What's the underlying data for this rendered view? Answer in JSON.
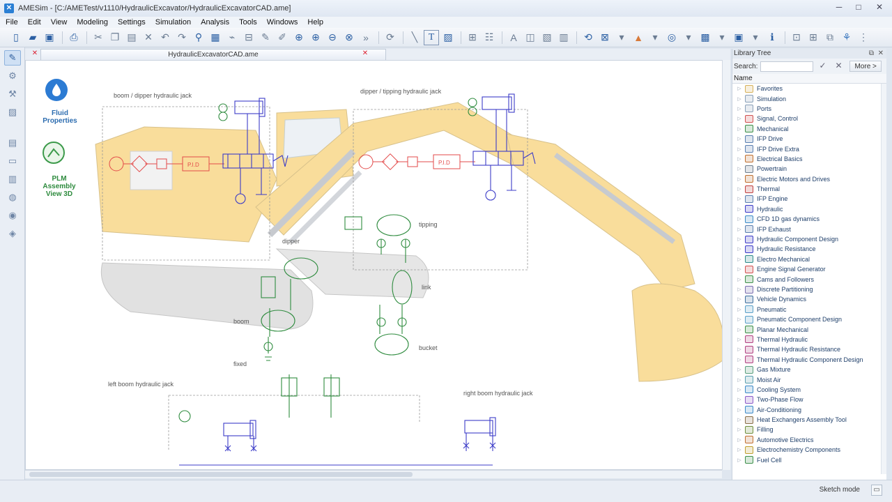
{
  "window": {
    "app_name": "AMESim",
    "path": "[C:/AMETest/v1110/HydraulicExcavator/HydraulicExcavatorCAD.ame]",
    "minimize_glyph": "─",
    "maximize_glyph": "□",
    "close_glyph": "✕"
  },
  "menu": [
    "File",
    "Edit",
    "View",
    "Modeling",
    "Settings",
    "Simulation",
    "Analysis",
    "Tools",
    "Windows",
    "Help"
  ],
  "toolbar": {
    "new_icon": "new-file-icon",
    "open_icon": "open-folder-icon",
    "save_icon": "save-icon",
    "print_icon": "print-icon",
    "text_glyph": "T"
  },
  "document": {
    "tab_title": "HydraulicExcavatorCAD.ame",
    "tab_close": "✕",
    "panel_close": "✕"
  },
  "canvas": {
    "fluid_properties_line1": "Fluid",
    "fluid_properties_line2": "Properties",
    "plm_line1": "PLM",
    "plm_line2": "Assembly",
    "plm_line3": "View 3D",
    "labels": {
      "boom_dipper_jack": "boom / dipper hydraulic jack",
      "dipper_tipping_jack": "dipper / tipping hydraulic jack",
      "tipping": "tipping",
      "dipper": "dipper",
      "link": "link",
      "boom": "boom",
      "bucket": "bucket",
      "fixed": "fixed",
      "left_boom_jack": "left boom hydraulic jack",
      "right_boom_jack": "right boom hydraulic jack",
      "pid_left": "P.I.D",
      "pid_right": "P.I.D"
    },
    "colors": {
      "control_red": "#e34a4a",
      "hydraulic_blue": "#3c3cc8",
      "mechanical_green": "#2e8b3e",
      "excavator_yellow": "#f6c75a"
    }
  },
  "library": {
    "title": "Library Tree",
    "search_label": "Search:",
    "search_value": "",
    "more_label": "More >",
    "column_name": "Name",
    "items": [
      {
        "label": "Favorites",
        "color": "#d6b15a"
      },
      {
        "label": "Simulation",
        "color": "#8aa0b8"
      },
      {
        "label": "Ports",
        "color": "#8aa0b8"
      },
      {
        "label": "Signal, Control",
        "color": "#d05050"
      },
      {
        "label": "Mechanical",
        "color": "#3d8f4a"
      },
      {
        "label": "IFP Drive",
        "color": "#5a7fb0"
      },
      {
        "label": "IFP Drive Extra",
        "color": "#5a7fb0"
      },
      {
        "label": "Electrical Basics",
        "color": "#c07030"
      },
      {
        "label": "Powertrain",
        "color": "#6f7f8f"
      },
      {
        "label": "Electric Motors and Drives",
        "color": "#c07030"
      },
      {
        "label": "Thermal",
        "color": "#c04040"
      },
      {
        "label": "IFP Engine",
        "color": "#5a7fb0"
      },
      {
        "label": "Hydraulic",
        "color": "#3c3cc8"
      },
      {
        "label": "CFD 1D gas dynamics",
        "color": "#3c8ac8"
      },
      {
        "label": "IFP Exhaust",
        "color": "#5a7fb0"
      },
      {
        "label": "Hydraulic Component Design",
        "color": "#3c3cc8"
      },
      {
        "label": "Hydraulic Resistance",
        "color": "#3c3cc8"
      },
      {
        "label": "Electro Mechanical",
        "color": "#2e8b8b"
      },
      {
        "label": "Engine Signal Generator",
        "color": "#d05050"
      },
      {
        "label": "Cams and Followers",
        "color": "#3d8f4a"
      },
      {
        "label": "Discrete Partitioning",
        "color": "#7a6fb0"
      },
      {
        "label": "Vehicle Dynamics",
        "color": "#3d6f9f"
      },
      {
        "label": "Pneumatic",
        "color": "#5aa0c8"
      },
      {
        "label": "Pneumatic Component Design",
        "color": "#5aa0c8"
      },
      {
        "label": "Planar Mechanical",
        "color": "#3d8f4a"
      },
      {
        "label": "Thermal Hydraulic",
        "color": "#b04080"
      },
      {
        "label": "Thermal Hydraulic Resistance",
        "color": "#b04080"
      },
      {
        "label": "Thermal Hydraulic Component Design",
        "color": "#b04080"
      },
      {
        "label": "Gas Mixture",
        "color": "#5a9f7f"
      },
      {
        "label": "Moist Air",
        "color": "#5a9fb0"
      },
      {
        "label": "Cooling System",
        "color": "#3c8ac8"
      },
      {
        "label": "Two-Phase Flow",
        "color": "#8a5ac8"
      },
      {
        "label": "Air-Conditioning",
        "color": "#3c8ac8"
      },
      {
        "label": "Heat Exchangers Assembly Tool",
        "color": "#8a6f4a"
      },
      {
        "label": "Filling",
        "color": "#6f8f3d"
      },
      {
        "label": "Automotive Electrics",
        "color": "#c07030"
      },
      {
        "label": "Electrochemistry Components",
        "color": "#c0a030"
      },
      {
        "label": "Fuel Cell",
        "color": "#3d8f4a"
      }
    ]
  },
  "status": {
    "mode": "Sketch mode"
  }
}
